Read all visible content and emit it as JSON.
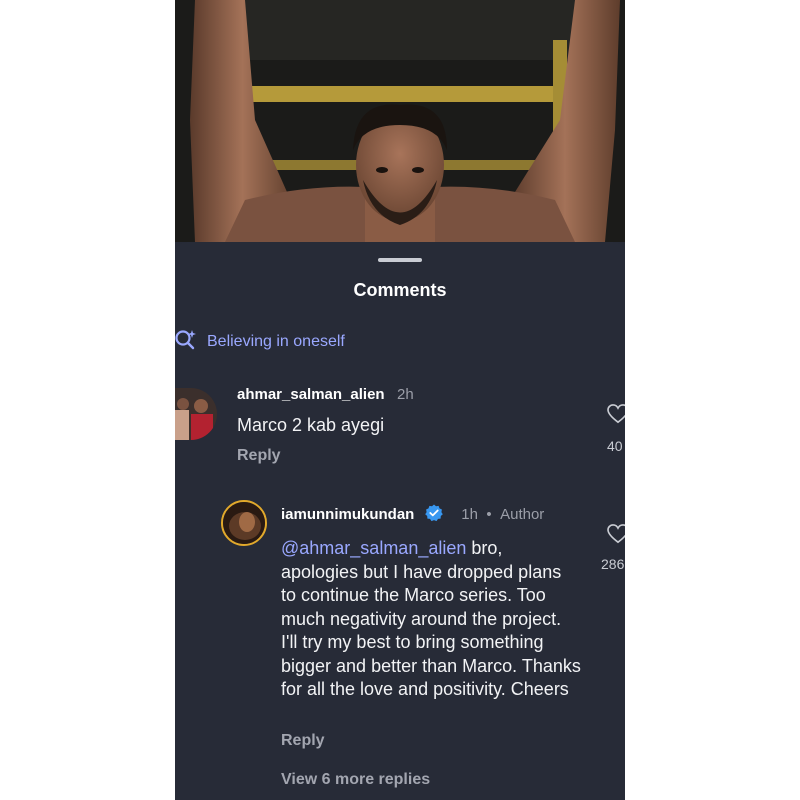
{
  "sheet": {
    "title": "Comments"
  },
  "search": {
    "suggestion": "Believing in oneself"
  },
  "comments": [
    {
      "username": "ahmar_salman_alien",
      "time": "2h",
      "text": "Marco 2 kab ayegi",
      "reply_label": "Reply",
      "like_count": "40"
    },
    {
      "username": "iamunnimukundan",
      "time": "1h",
      "separator": "•",
      "role": "Author",
      "mention": "@ahmar_salman_alien",
      "text": " bro, apologies but I have dropped plans to continue the Marco series. Too much negativity around the project. I'll try my best to bring something bigger and better than Marco. Thanks for all the love and positivity. Cheers",
      "reply_label": "Reply",
      "like_count": "286",
      "view_more": "View 6 more replies"
    }
  ],
  "colors": {
    "sheet_bg": "#272b37",
    "accent": "#9aa8ff",
    "verified": "#3897f0"
  }
}
